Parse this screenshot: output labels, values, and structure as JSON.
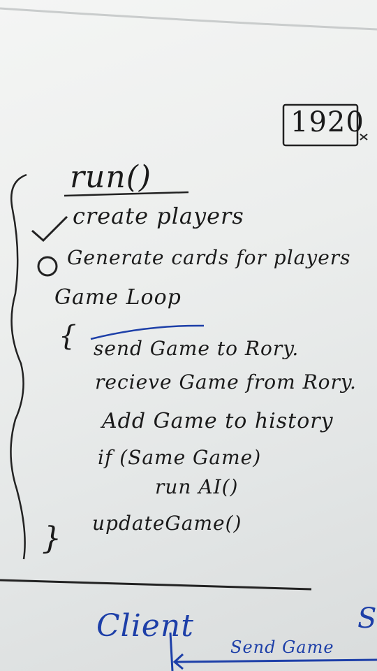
{
  "whiteboard": {
    "box_number": "1920",
    "title": "run()",
    "steps": {
      "create_players": "create players",
      "generate_cards": "Generate cards for players",
      "game_loop": "Game Loop"
    },
    "loop": {
      "open_brace": "{",
      "send_game": "send Game to Rory.",
      "receive_game": "recieve Game from Rory.",
      "add_game": "Add Game to history",
      "if_same": "if (Same Game)",
      "run_ai": "run AI()",
      "close_brace": "}",
      "update_game": "updateGame()"
    },
    "bottom": {
      "client": "Client",
      "send_game": "Send Game",
      "cut_letter": "S"
    },
    "ink": {
      "black": "#1a1a1a",
      "blue": "#1d3fa8"
    }
  }
}
